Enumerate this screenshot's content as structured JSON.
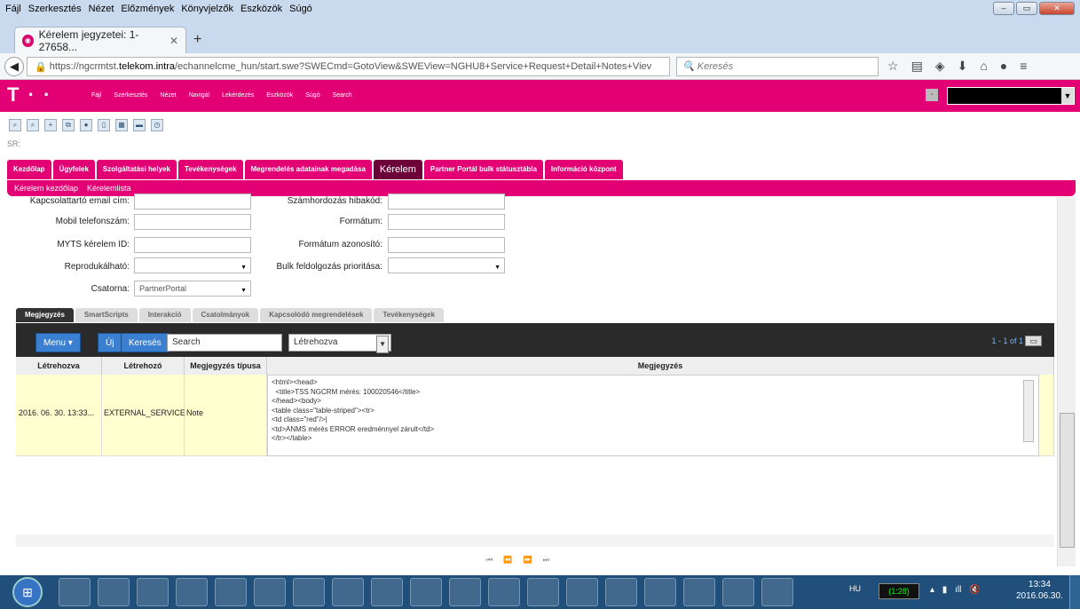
{
  "menubar": {
    "items": [
      "Fájl",
      "Szerkesztés",
      "Nézet",
      "Előzmények",
      "Könyvjelzők",
      "Eszközök",
      "Súgó"
    ]
  },
  "browser": {
    "tab_title": "Kérelem jegyzetei: 1-27658...",
    "url_prefix": "https://ngcrmtst.",
    "url_domain": "telekom.intra",
    "url_rest": "/echannelcme_hun/start.swe?SWECmd=GotoView&SWEView=NGHU8+Service+Request+Detail+Notes+Viev",
    "search_placeholder": "Keresés"
  },
  "app": {
    "logo": "T · ·",
    "menus": [
      "Fájl",
      "Szerkesztés",
      "Nézet",
      "Navigál",
      "Lekérdezés",
      "Eszközök",
      "Súgó",
      "Search"
    ],
    "sr_label": "SR:",
    "screen_tabs": [
      "Kezdőlap",
      "Ügyfelek",
      "Szolgáltatási helyek",
      "Tevékenységek",
      "Megrendelés adatainak megadása",
      "Kérelem",
      "Partner Portál bulk státusztábla",
      "Információ központ"
    ],
    "subnav": [
      "Kérelem kezdőlap",
      "Kérelemlista"
    ]
  },
  "form": {
    "fields_left": [
      {
        "label": "Kapcsolattartó email cím:",
        "value": ""
      },
      {
        "label": "Mobil telefonszám:",
        "value": ""
      },
      {
        "label": "MYTS kérelem ID:",
        "value": ""
      },
      {
        "label": "Reprodukálható:",
        "value": ""
      },
      {
        "label": "Csatorna:",
        "value": "PartnerPortal"
      }
    ],
    "fields_right": [
      {
        "label": "Számhordozás hibakód:",
        "value": ""
      },
      {
        "label": "Formátum:",
        "value": ""
      },
      {
        "label": "Formátum azonosító:",
        "value": ""
      },
      {
        "label": "Bulk feldolgozás prioritása:",
        "value": ""
      }
    ]
  },
  "view_tabs": [
    "Megjegyzés",
    "SmartScripts",
    "Interakció",
    "Csatolmányok",
    "Kapcsolódó megrendelések",
    "Tevékenységek"
  ],
  "list": {
    "menu_label": "Menu",
    "new_label": "Új",
    "search_label": "Keresés",
    "search_value": "Search",
    "sort_value": "Létrehozva",
    "pager": "1 - 1 of 1",
    "columns": [
      "Létrehozva",
      "Létrehozó",
      "Megjegyzés típusa",
      "Megjegyzés"
    ],
    "row": {
      "created": "2016. 06. 30. 13:33...",
      "creator": "EXTERNAL_SERVICE",
      "type": "Note",
      "note": "<html><head>\n  <title>TSS NGCRM mérés: 100020546</title>\n</head><body>\n<table class=\"table-striped\"><tr>\n<td class=\"red\"/>|\n<td>ANMS mérés ERROR eredménnyel zárult</td>\n</tr></table>"
    },
    "grid_pager": "⏮ ⏪ ⏩ ⏭"
  },
  "taskbar": {
    "lang": "HU",
    "battery": "(1:28)",
    "time": "13:34",
    "date": "2016.06.30."
  }
}
